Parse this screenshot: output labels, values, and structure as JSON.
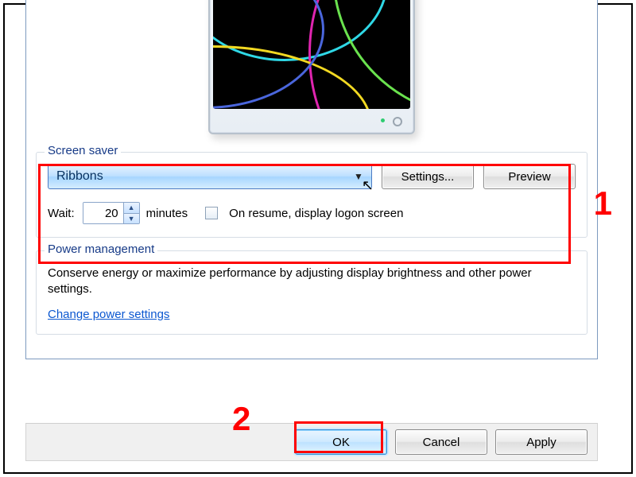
{
  "screenSaver": {
    "legend": "Screen saver",
    "dropdown_value": "Ribbons",
    "settings_btn": "Settings...",
    "preview_btn": "Preview",
    "wait_label": "Wait:",
    "wait_value": "20",
    "minutes_label": "minutes",
    "checkbox_label": "On resume, display logon screen"
  },
  "powerMgmt": {
    "legend": "Power management",
    "text": "Conserve energy or maximize performance by adjusting display brightness and other power settings.",
    "link": "Change power settings"
  },
  "buttons": {
    "ok": "OK",
    "cancel": "Cancel",
    "apply": "Apply"
  },
  "annotations": {
    "n1": "1",
    "n2": "2"
  }
}
